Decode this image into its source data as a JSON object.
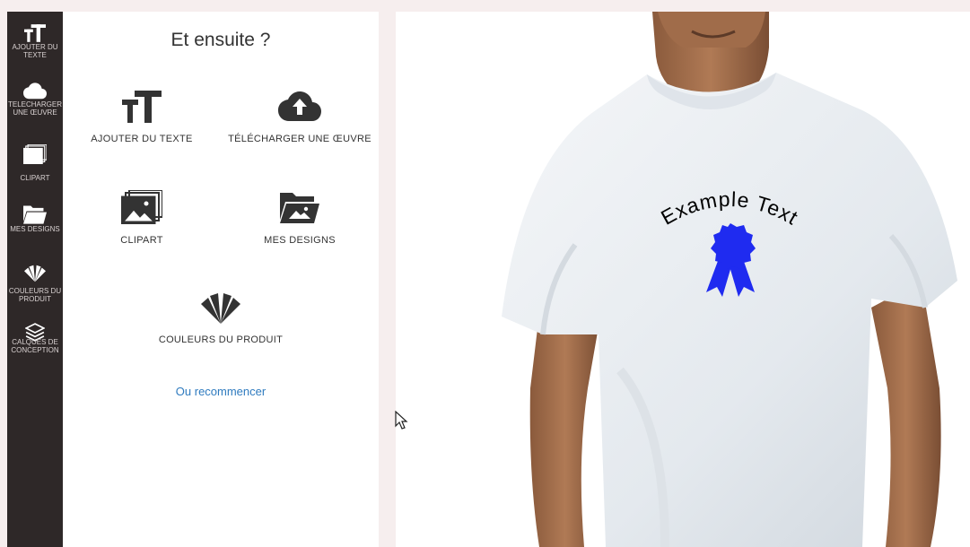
{
  "toolbar": {
    "items": [
      {
        "label": "AJOUTER DU TEXTE",
        "icon": "text-size-icon"
      },
      {
        "label": "TÉLÉCHARGER UNE ŒUVRE",
        "icon": "cloud-upload-icon"
      },
      {
        "label": "CLIPART",
        "icon": "images-icon"
      },
      {
        "label": "MES DESIGNS",
        "icon": "folder-image-icon"
      },
      {
        "label": "COULEURS DU PRODUIT",
        "icon": "color-swatch-icon"
      },
      {
        "label": "CALQUES DE CONCEPTION",
        "icon": "layers-icon"
      }
    ]
  },
  "panel": {
    "title": "Et ensuite ?",
    "options": [
      {
        "label": "AJOUTER DU TEXTE",
        "icon": "text-size-icon"
      },
      {
        "label": "TÉLÉCHARGER UNE ŒUVRE",
        "icon": "cloud-upload-icon"
      },
      {
        "label": "CLIPART",
        "icon": "images-icon"
      },
      {
        "label": "MES DESIGNS",
        "icon": "folder-image-icon"
      },
      {
        "label": "COULEURS DU PRODUIT",
        "icon": "color-swatch-icon"
      }
    ],
    "restart_link": "Ou recommencer"
  },
  "design": {
    "text": "Example Text",
    "text_color": "#333333",
    "clipart": "ribbon-award-icon",
    "clipart_color": "#1f2bf0",
    "product_color": "#ffffff"
  },
  "colors": {
    "toolbar_bg": "#2e2828",
    "accent_link": "#2f7bbf",
    "page_bg": "#f6eeee"
  }
}
